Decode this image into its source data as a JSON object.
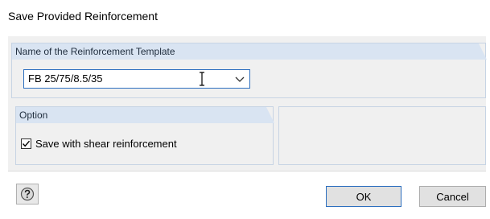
{
  "window": {
    "title": "Save Provided Reinforcement"
  },
  "name_group": {
    "header": "Name of the Reinforcement Template",
    "combo_value": "FB 25/75/8.5/35"
  },
  "option_group": {
    "header": "Option",
    "checkbox_label": "Save with shear reinforcement",
    "checkbox_checked": true
  },
  "footer": {
    "ok_label": "OK",
    "cancel_label": "Cancel"
  },
  "colors": {
    "group_header_bg": "#d9e4f2",
    "focus_border": "#2d6fbf",
    "panel_bg": "#f0f0f0"
  }
}
